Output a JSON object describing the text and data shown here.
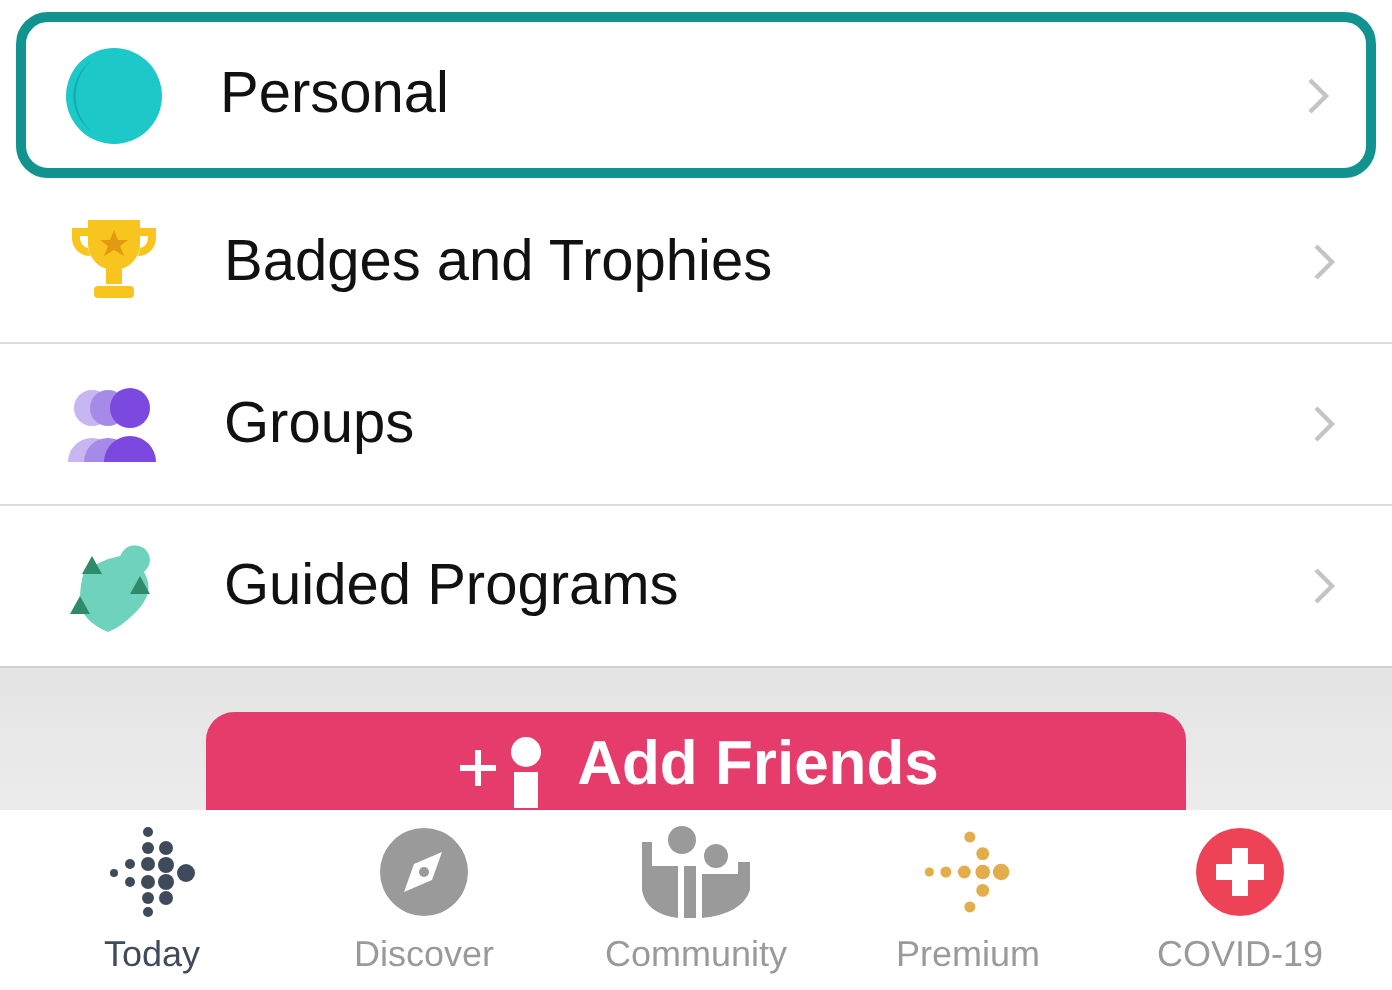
{
  "menu": [
    {
      "label": "Personal",
      "kind": "avatar",
      "selected": true
    },
    {
      "label": "Badges and Trophies",
      "kind": "trophy",
      "selected": false
    },
    {
      "label": "Groups",
      "kind": "groups",
      "selected": false
    },
    {
      "label": "Guided Programs",
      "kind": "programs",
      "selected": false
    }
  ],
  "add_button": {
    "label": "Add Friends"
  },
  "tabs": [
    {
      "label": "Today",
      "kind": "today",
      "selected": true
    },
    {
      "label": "Discover",
      "kind": "discover",
      "selected": false
    },
    {
      "label": "Community",
      "kind": "community",
      "selected": false
    },
    {
      "label": "Premium",
      "kind": "premium",
      "selected": false
    },
    {
      "label": "COVID-19",
      "kind": "covid",
      "selected": false
    }
  ]
}
